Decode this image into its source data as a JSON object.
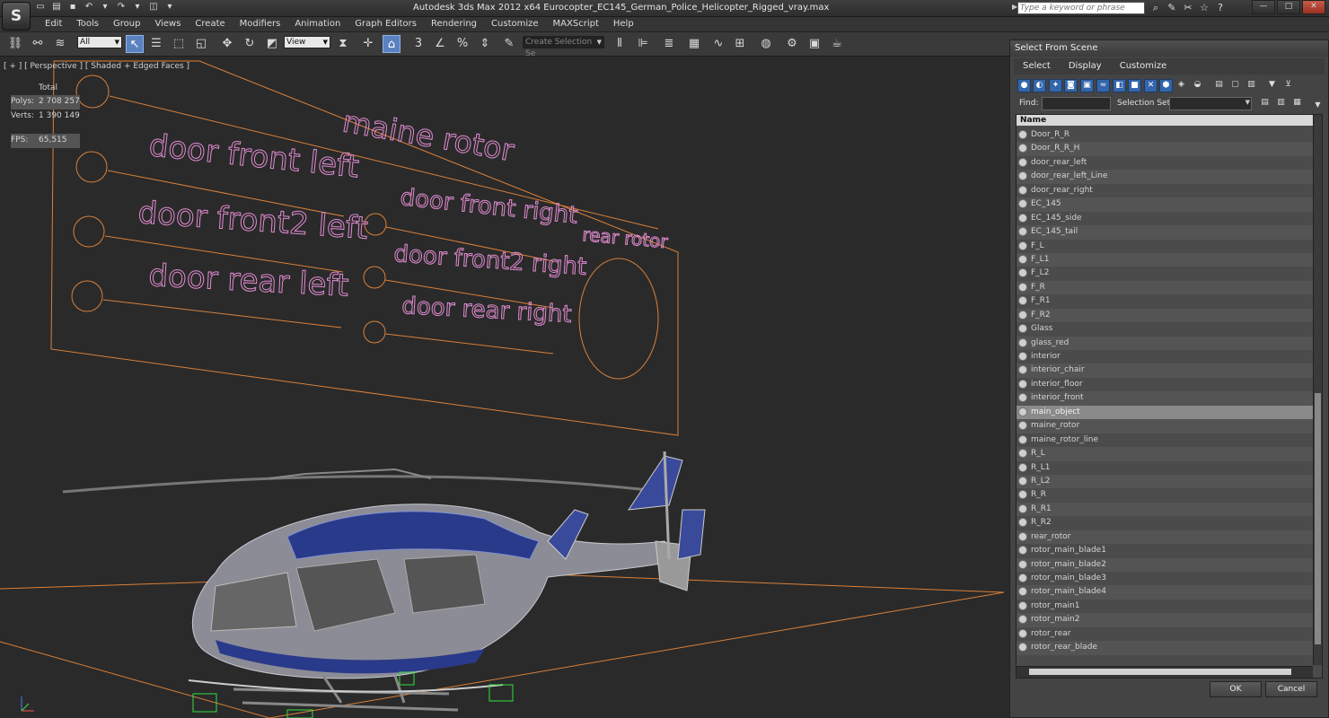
{
  "app": {
    "title": "Autodesk 3ds Max  2012 x64      Eurocopter_EC145_German_Police_Helicopter_Rigged_vray.max",
    "search_placeholder": "Type a keyword or phrase"
  },
  "menu": [
    "Edit",
    "Tools",
    "Group",
    "Views",
    "Create",
    "Modifiers",
    "Animation",
    "Graph Editors",
    "Rendering",
    "Customize",
    "MAXScript",
    "Help"
  ],
  "toolbar": {
    "filter_value": "All",
    "refcoord_value": "View",
    "selection_set_placeholder": "Create Selection Se"
  },
  "viewport": {
    "label": "[ + ] [ Perspective ] [ Shaded + Edged Faces ]",
    "stats": {
      "total_label": "Total",
      "polys_label": "Polys:",
      "polys_value": "2 708 257",
      "verts_label": "Verts:",
      "verts_value": "1 390 149",
      "fps_label": "FPS:",
      "fps_value": "65,515"
    },
    "rig_labels": {
      "main": "maine rotor",
      "front_left": "door front left",
      "front2_left": "door front2 left",
      "rear_left": "door rear left",
      "front_right": "door front right",
      "front2_right": "door front2 right",
      "rear_right": "door rear right",
      "rear_rotor": "rear rotor"
    },
    "colors": {
      "shape": "#d9803a",
      "text": "#e08bd0",
      "stats": "#f0e050"
    }
  },
  "panel": {
    "title": "Select From Scene",
    "menu": [
      "Select",
      "Display",
      "Customize"
    ],
    "find_label": "Find:",
    "selection_set_label": "Selection Set:",
    "column_header": "Name",
    "selected_item": "main_object",
    "items": [
      "Door_R_R",
      "Door_R_R_H",
      "door_rear_left",
      "door_rear_left_Line",
      "door_rear_right",
      "EC_145",
      "EC_145_side",
      "EC_145_tail",
      "F_L",
      "F_L1",
      "F_L2",
      "F_R",
      "F_R1",
      "F_R2",
      "Glass",
      "glass_red",
      "interior",
      "interior_chair",
      "interior_floor",
      "interior_front",
      "main_object",
      "maine_rotor",
      "maine_rotor_line",
      "R_L",
      "R_L1",
      "R_L2",
      "R_R",
      "R_R1",
      "R_R2",
      "rear_rotor",
      "rotor_main_blade1",
      "rotor_main_blade2",
      "rotor_main_blade3",
      "rotor_main_blade4",
      "rotor_main1",
      "rotor_main2",
      "rotor_rear",
      "rotor_rear_blade"
    ],
    "ok_label": "OK",
    "cancel_label": "Cancel"
  }
}
